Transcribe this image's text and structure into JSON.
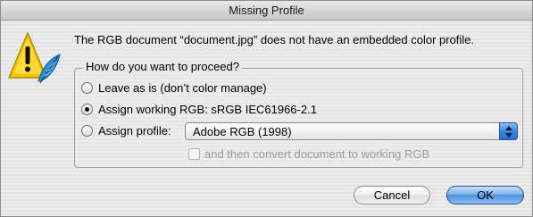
{
  "window": {
    "title": "Missing Profile"
  },
  "icon": {
    "name": "warning-icon",
    "accent": "#f5c400"
  },
  "message": "The RGB document “document.jpg” does not have an embedded color profile.",
  "options_group": {
    "title": "How do you want to proceed?",
    "options": [
      {
        "label": "Leave as is (don’t color manage)",
        "selected": false
      },
      {
        "label": "Assign working RGB:  sRGB IEC61966-2.1",
        "selected": true
      },
      {
        "label": "Assign profile:",
        "selected": false
      }
    ],
    "profile_select": {
      "value": "Adobe RGB (1998)",
      "icon": "updown-arrows-icon"
    },
    "convert_checkbox": {
      "label": "and then convert document to working RGB",
      "checked": false,
      "disabled": true
    }
  },
  "buttons": {
    "cancel": "Cancel",
    "ok": "OK"
  },
  "colors": {
    "default_button": "#4e90e2",
    "window_bg": "#ececec"
  }
}
